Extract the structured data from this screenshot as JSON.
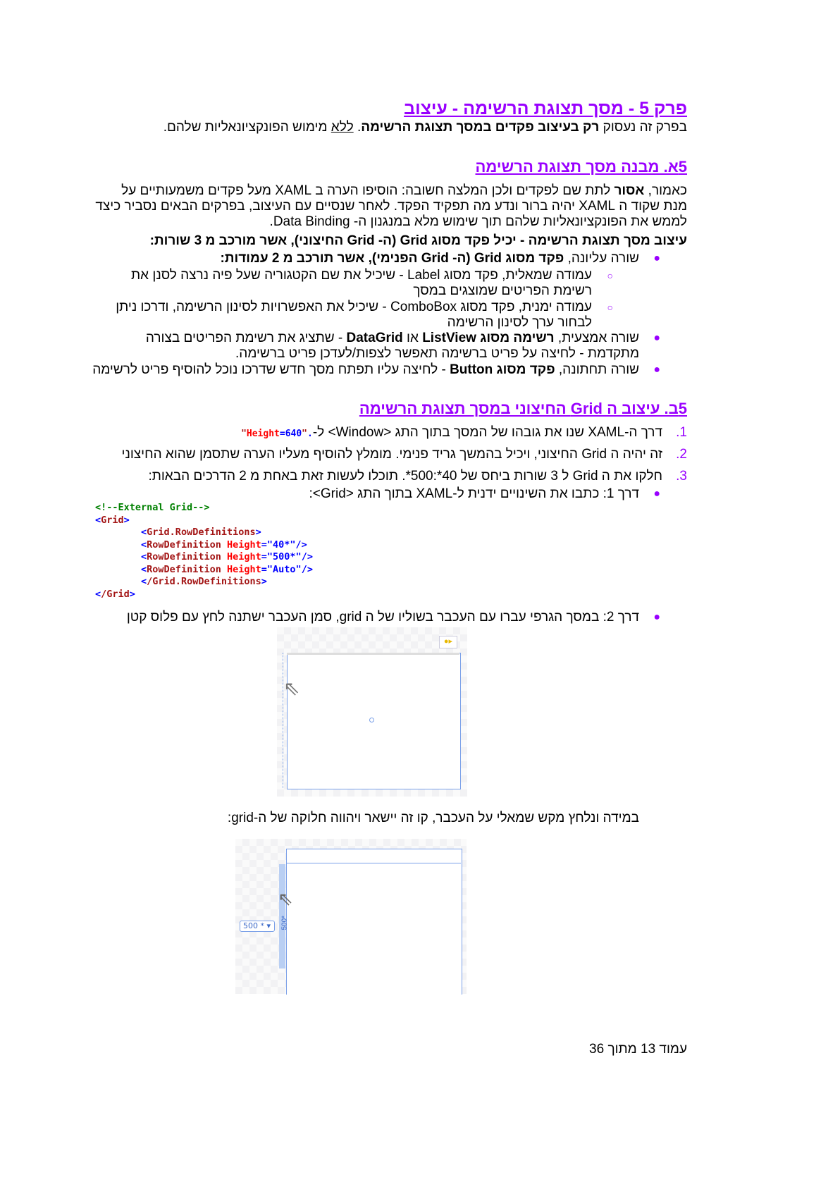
{
  "title": "פרק 5 - מסך תצוגת הרשימה - עיצוב",
  "intro": {
    "a": "בפרק זה נעסוק ",
    "b": "רק בעיצוב פקדים במסך תצוגת הרשימה",
    "c": ". ",
    "d": "ללא",
    "e": " מימוש הפונקציונאליות שלהם."
  },
  "section_a": {
    "heading": "5א. מבנה מסך תצוגת הרשימה",
    "para": {
      "a": "כאמור, ",
      "b": "אסור",
      "c": " לתת שם לפקדים ולכן המלצה חשובה: הוסיפו הערה ב XAML מעל פקדים משמעותיים על מנת שקוד ה XAML יהיה ברור ונדע מה תפקיד הפקד. לאחר שנסיים עם העיצוב, בפרקים הבאים נסביר כיצד לממש את הפונקציונאליות שלהם תוך שימוש מלא במנגנון ה- Data Binding."
    },
    "lead": "עיצוב מסך תצוגת הרשימה - יכיל פקד מסוג Grid (ה- Grid החיצוני), אשר מורכב מ 3 שורות:",
    "row1": {
      "a": "שורה עליונה, ",
      "b": "פקד מסוג Grid (ה- Grid הפנימי), אשר תורכב מ 2 עמודות:"
    },
    "col_left": "עמודה שמאלית, פקד מסוג Label - שיכיל את שם הקטגוריה שעל פיה נרצה לסנן את רשימת הפריטים שמוצגים במסך",
    "col_right": "עמודה ימנית, פקד מסוג ComboBox - שיכיל את האפשרויות לסינון הרשימה, ודרכו ניתן לבחור ערך לסינון הרשימה",
    "row2": {
      "a": "שורה אמצעית, ",
      "b": "רשימה מסוג ListView",
      "c": " או ",
      "d": "DataGrid",
      "e": " - שתציג את רשימת הפריטים בצורה מתקדמת - לחיצה על פריט ברשימה תאפשר לצפות/לעדכן פריט ברשימה."
    },
    "row3": {
      "a": "שורה תחתונה, ",
      "b": "פקד מסוג Button",
      "c": " - לחיצה עליו תפתח מסך חדש שדרכו נוכל להוסיף פריט לרשימה"
    }
  },
  "section_b": {
    "heading": "5ב. עיצוב ה Grid החיצוני במסך תצוגת הרשימה",
    "step1": {
      "num": "1.",
      "text": "דרך ה-XAML שנו את גובהו של המסך בתוך התג <Window> ל-",
      "q1": "\"",
      "attr": "Height",
      "eq": "=",
      "val": "640",
      "q2": "\"",
      "end": "."
    },
    "step2": {
      "num": "2.",
      "text": "זה יהיה ה Grid החיצוני, ויכיל בהמשך גריד פנימי. מומלץ להוסיף מעליו הערה שתסמן שהוא החיצוני"
    },
    "step3": {
      "num": "3.",
      "text": "חלקו את ה Grid ל 3 שורות ביחס של 40*:500*. תוכלו לעשות זאת באחת מ 2 הדרכים הבאות:"
    },
    "way1": "דרך 1: כתבו את השינויים ידנית ל-XAML בתוך התג <Grid>:",
    "code": {
      "comment": "<!--External Grid-->",
      "grid_open": "Grid",
      "rowdefs_open": "Grid.RowDefinitions",
      "rowdef": "RowDefinition",
      "height_attr": "Height",
      "rows": [
        "\"40*\"",
        "\"500*\"",
        "\"Auto\""
      ],
      "rowdefs_close": "/Grid.RowDefinitions",
      "grid_close": "/Grid"
    },
    "way2": "דרך 2: במסך הגרפי עברו עם העכבר בשוליו של ה grid, סמן העכבר ישתנה לחץ עם פלוס קטן",
    "after_click": "במידה ונלחץ מקש שמאלי על העכבר, קו זה יישאר ויהווה חלוקה של ה-grid:",
    "designer_row_value": "500",
    "designer_star": "*",
    "designer_side_label": "500*"
  },
  "footer": "עמוד 13 מתוך 36"
}
